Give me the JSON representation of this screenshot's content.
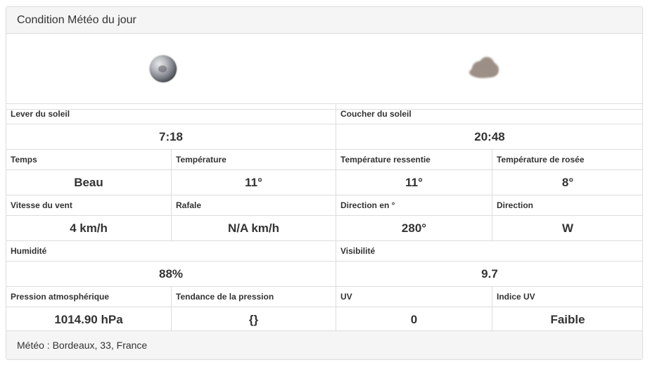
{
  "panel": {
    "title": "Condition Météo du jour",
    "footer": "Météo : Bordeaux, 33, France"
  },
  "icons": {
    "left": "moon-icon",
    "right": "cloud-icon"
  },
  "rows": {
    "sunrise_label": "Lever du soleil",
    "sunrise_value": "7:18",
    "sunset_label": "Coucher du soleil",
    "sunset_value": "20:48",
    "weather_label": "Temps",
    "weather_value": "Beau",
    "temp_label": "Température",
    "temp_value": "11°",
    "feels_label": "Température ressentie",
    "feels_value": "11°",
    "dew_label": "Température de rosée",
    "dew_value": "8°",
    "wind_label": "Vitesse du vent",
    "wind_value": "4 km/h",
    "gust_label": "Rafale",
    "gust_value": "N/A km/h",
    "dir_deg_label": "Direction en °",
    "dir_deg_value": "280°",
    "dir_label": "Direction",
    "dir_value": "W",
    "humidity_label": "Humidité",
    "humidity_value": "88%",
    "visibility_label": "Visibilité",
    "visibility_value": "9.7",
    "pressure_label": "Pression atmosphérique",
    "pressure_value": "1014.90 hPa",
    "trend_label": "Tendance de la pression",
    "trend_value": "{}",
    "uv_label": "UV",
    "uv_value": "0",
    "uv_index_label": "Indice UV",
    "uv_index_value": "Faible"
  }
}
